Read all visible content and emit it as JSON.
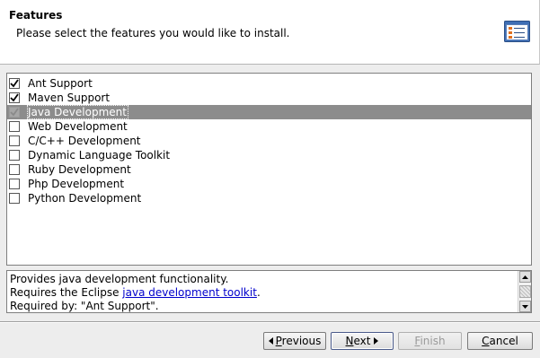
{
  "header": {
    "title": "Features",
    "subtitle": "Please select the features you would like to install.",
    "icon": "feature-list-icon"
  },
  "features": [
    {
      "label": "Ant Support",
      "checked": true,
      "enabled": true,
      "selected": false
    },
    {
      "label": "Maven Support",
      "checked": true,
      "enabled": true,
      "selected": false
    },
    {
      "label": "Java Development",
      "checked": true,
      "enabled": false,
      "selected": true
    },
    {
      "label": "Web Development",
      "checked": false,
      "enabled": true,
      "selected": false
    },
    {
      "label": "C/C++ Development",
      "checked": false,
      "enabled": true,
      "selected": false
    },
    {
      "label": "Dynamic Language Toolkit",
      "checked": false,
      "enabled": true,
      "selected": false
    },
    {
      "label": "Ruby Development",
      "checked": false,
      "enabled": true,
      "selected": false
    },
    {
      "label": "Php Development",
      "checked": false,
      "enabled": true,
      "selected": false
    },
    {
      "label": "Python Development",
      "checked": false,
      "enabled": true,
      "selected": false
    }
  ],
  "description": {
    "line1": "Provides java development functionality.",
    "line2_prefix": "Requires the Eclipse ",
    "line2_link": "java development toolkit",
    "line2_suffix": ".",
    "line3": "Required by: \"Ant Support\"."
  },
  "buttons": {
    "previous": "Previous",
    "next": "Next",
    "finish": "Finish",
    "cancel": "Cancel"
  },
  "colors": {
    "selection": "#8c8c8c",
    "link": "#0000cc",
    "background": "#ededed"
  }
}
